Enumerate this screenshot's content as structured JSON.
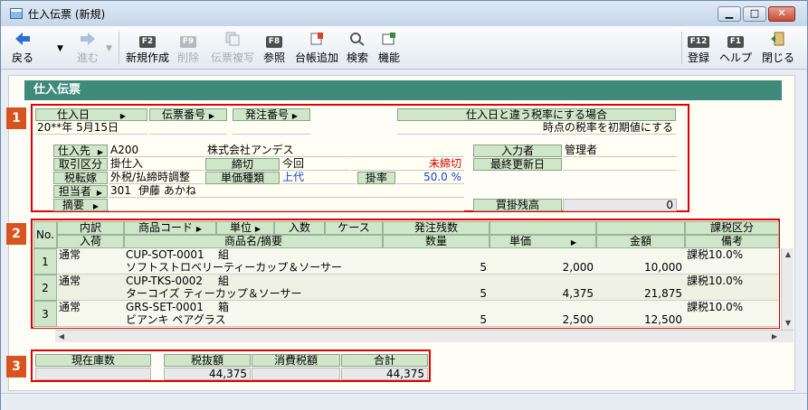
{
  "window": {
    "title": "仕入伝票 (新規)",
    "min": "▁",
    "max": "□",
    "close": "✕"
  },
  "toolbar": {
    "back": "戻る",
    "forward": "進む",
    "new": {
      "key": "F2",
      "label": "新規作成"
    },
    "delete": {
      "key": "F9",
      "label": "削除"
    },
    "copy": {
      "label": "伝票複写"
    },
    "ref": {
      "key": "F8",
      "label": "参照"
    },
    "ledger": {
      "label": "台帳追加"
    },
    "search": {
      "label": "検索"
    },
    "func": {
      "label": "機能"
    },
    "register": {
      "key": "F12",
      "label": "登録"
    },
    "help": {
      "key": "F1",
      "label": "ヘルプ"
    },
    "close": {
      "label": "閉じる"
    }
  },
  "section_title": "仕入伝票",
  "badges": [
    "1",
    "2",
    "3"
  ],
  "header": {
    "purchase_date_label": "仕入日",
    "slip_no_label": "伝票番号",
    "order_no_label": "発注番号",
    "purchase_date": "20**年 5月15日",
    "tax_rate_label": "仕入日と違う税率にする場合",
    "tax_rate_value": "時点の税率を初期値にする",
    "supplier_label": "仕入先",
    "supplier_code": "A200",
    "supplier_name": "株式会社アンデス",
    "trade_type_label": "取引区分",
    "trade_type": "掛仕入",
    "cutoff_label": "締切",
    "cutoff": "今回",
    "cutoff_status": "未締切",
    "tax_transfer_label": "税転嫁",
    "tax_transfer": "外税/払締時調整",
    "unit_price_type_label": "単価種類",
    "unit_price_type": "上代",
    "rate_label": "掛率",
    "rate": "50.0 %",
    "staff_label": "担当者",
    "staff_code": "301",
    "staff_name": "伊藤 あかね",
    "memo_label": "摘要",
    "entry_user_label": "入力者",
    "entry_user": "管理者",
    "last_update_label": "最終更新日",
    "last_update": "",
    "payable_balance_label": "買掛残高",
    "payable_balance": "0"
  },
  "grid": {
    "headers_row1": [
      "No.",
      "内訳",
      "商品コード",
      "単位",
      "入数",
      "ケース",
      "発注残数",
      "",
      "",
      "課税区分"
    ],
    "headers_row2": [
      "入荷",
      "商品名/摘要",
      "数量",
      "単価",
      "金額",
      "備考"
    ],
    "rows": [
      {
        "no": "1",
        "type": "通常",
        "code": "CUP-SOT-0001",
        "unit": "組",
        "name": "ソフトストロベリーティーカップ＆ソーサー",
        "qty": "5",
        "price": "2,000",
        "amount": "10,000",
        "tax": "課税10.0%"
      },
      {
        "no": "2",
        "type": "通常",
        "code": "CUP-TKS-0002",
        "unit": "組",
        "name": "ターコイズ ティーカップ＆ソーサー",
        "qty": "5",
        "price": "4,375",
        "amount": "21,875",
        "tax": "課税10.0%"
      },
      {
        "no": "3",
        "type": "通常",
        "code": "GRS-SET-0001",
        "unit": "箱",
        "name": "ビアンキ ペアグラス",
        "qty": "5",
        "price": "2,500",
        "amount": "12,500",
        "tax": "課税10.0%"
      }
    ]
  },
  "footer": {
    "stock_label": "現在庫数",
    "stock": "",
    "subtotal_label": "税抜額",
    "subtotal": "44,375",
    "tax_label": "消費税額",
    "tax": "",
    "total_label": "合計",
    "total": "44,375"
  },
  "colors": {
    "accent": "#3f8a7a",
    "label_bg": "#cfe6c9",
    "highlight": "#e00000",
    "badge": "#d9531e"
  }
}
